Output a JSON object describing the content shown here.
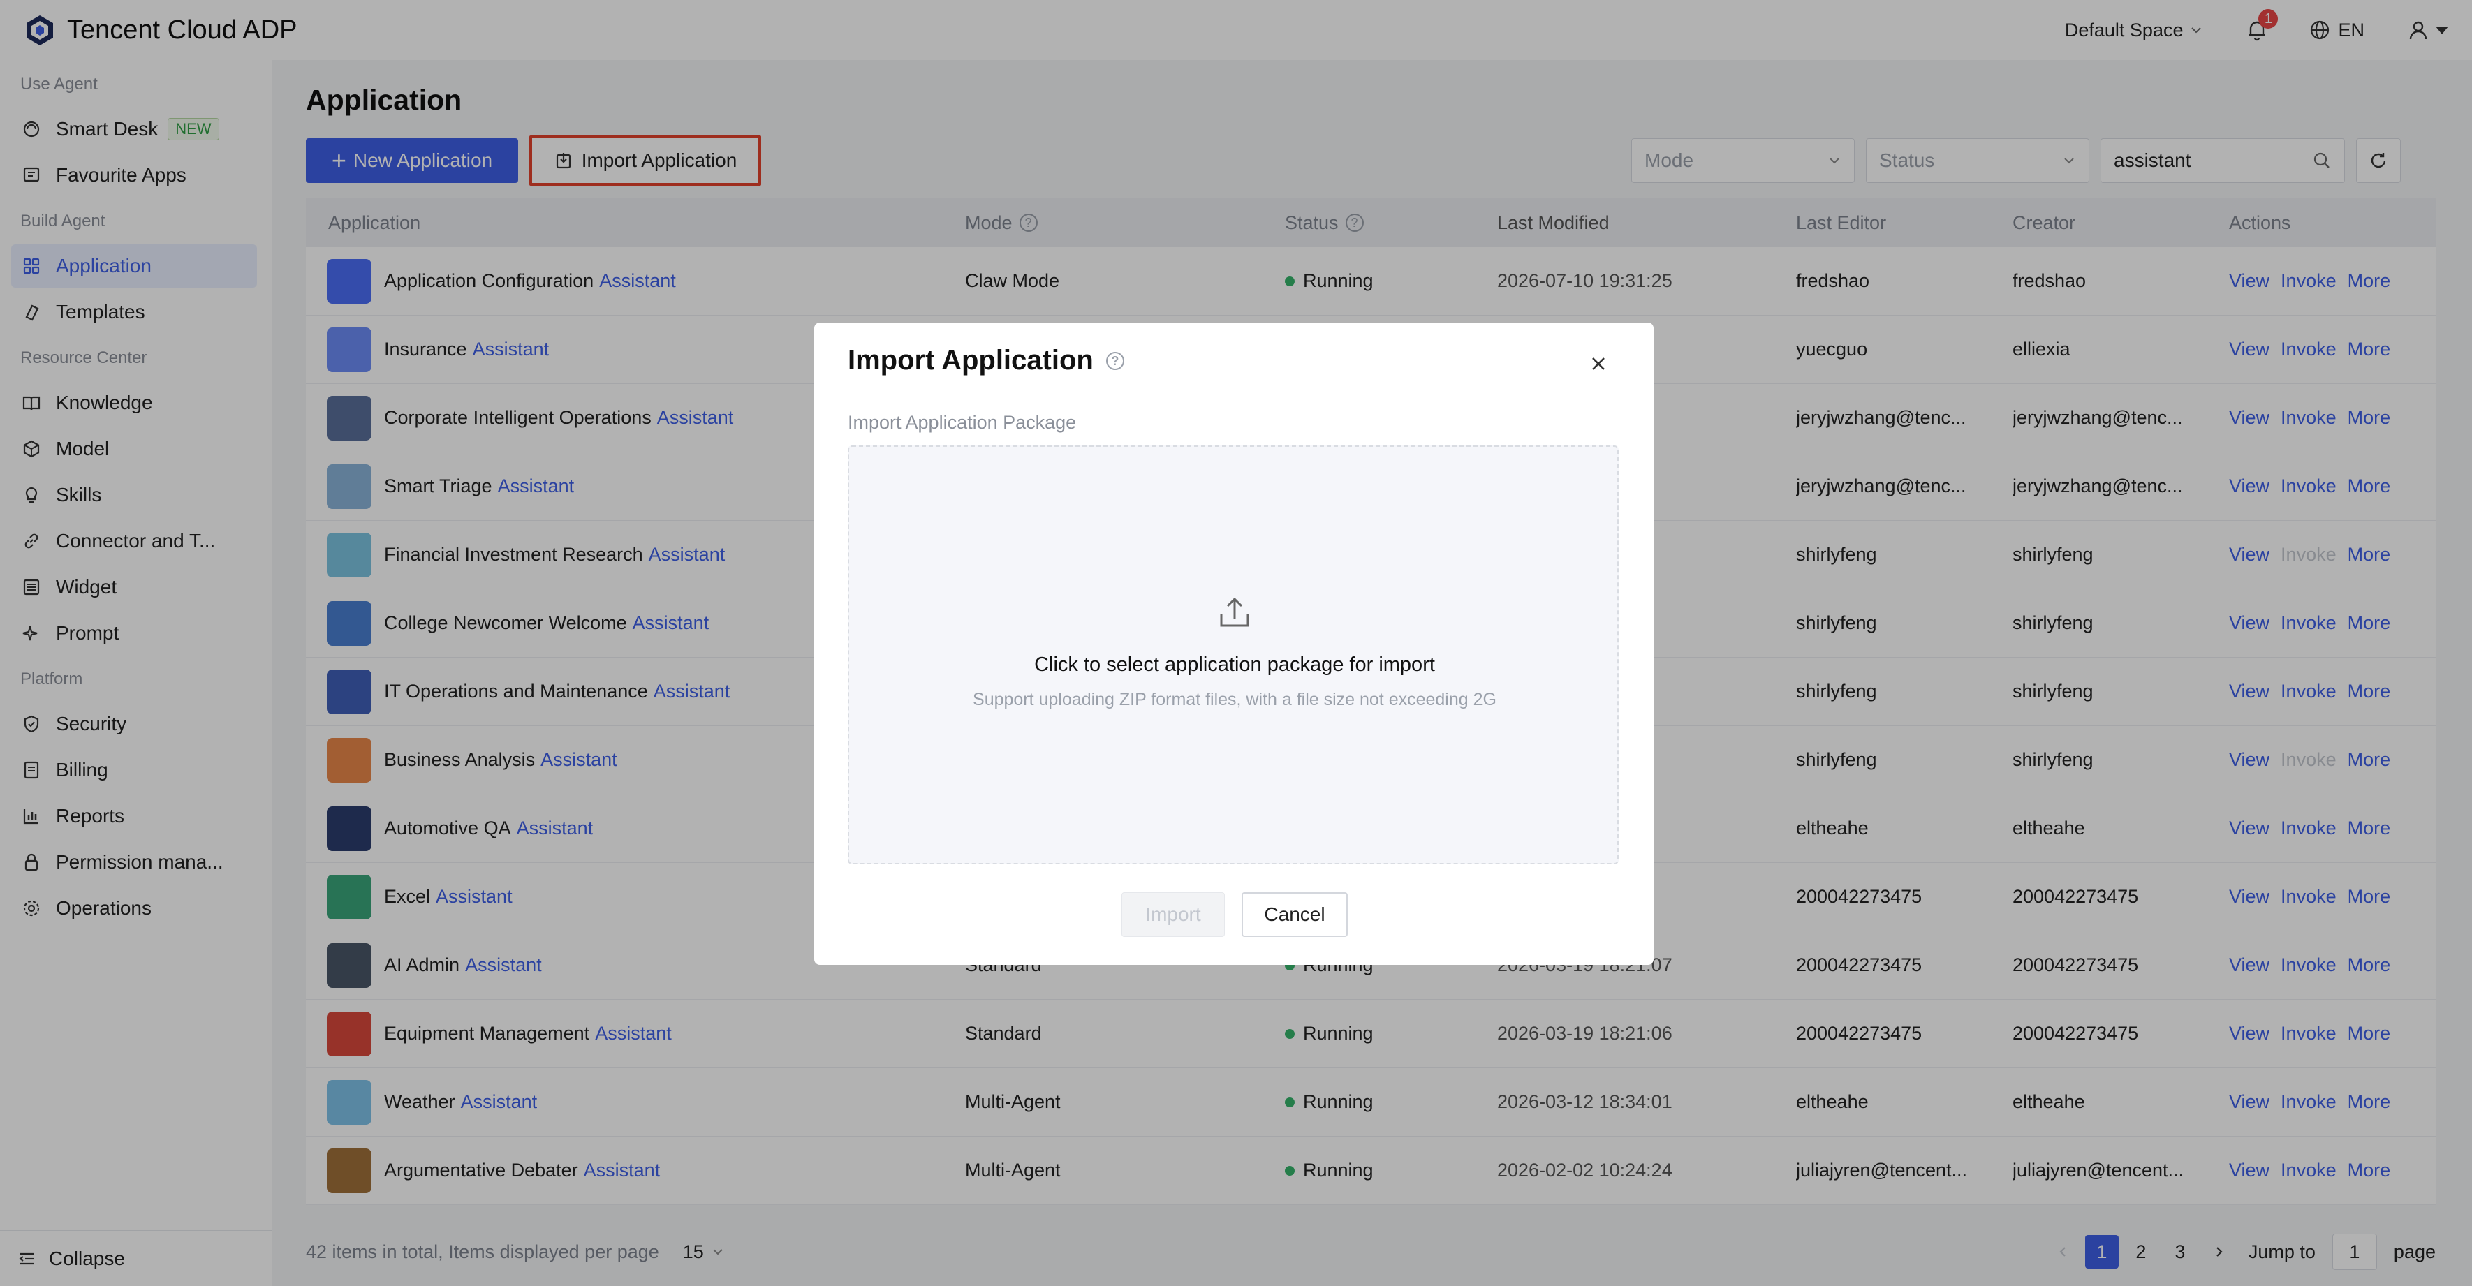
{
  "topbar": {
    "brand": "Tencent Cloud ADP",
    "space": "Default Space",
    "notifications": "1",
    "language": "EN"
  },
  "sidebar": {
    "groups": [
      {
        "title": "Use Agent",
        "items": [
          {
            "label": "Smart Desk",
            "icon": "smart-desk-icon",
            "badge": "NEW"
          },
          {
            "label": "Favourite Apps",
            "icon": "favourite-apps-icon"
          }
        ]
      },
      {
        "title": "Build Agent",
        "items": [
          {
            "label": "Application",
            "icon": "application-grid-icon",
            "active": true
          },
          {
            "label": "Templates",
            "icon": "templates-icon"
          }
        ]
      },
      {
        "title": "Resource Center",
        "items": [
          {
            "label": "Knowledge",
            "icon": "book-icon"
          },
          {
            "label": "Model",
            "icon": "cube-icon"
          },
          {
            "label": "Skills",
            "icon": "lightbulb-icon"
          },
          {
            "label": "Connector and T...",
            "icon": "link-icon"
          },
          {
            "label": "Widget",
            "icon": "widget-icon"
          },
          {
            "label": "Prompt",
            "icon": "sparkle-icon"
          }
        ]
      },
      {
        "title": "Platform",
        "items": [
          {
            "label": "Security",
            "icon": "shield-icon"
          },
          {
            "label": "Billing",
            "icon": "billing-icon"
          },
          {
            "label": "Reports",
            "icon": "bar-chart-icon"
          },
          {
            "label": "Permission mana...",
            "icon": "lock-icon"
          },
          {
            "label": "Operations",
            "icon": "gear-icon"
          }
        ]
      }
    ],
    "collapse": "Collapse"
  },
  "main": {
    "title": "Application",
    "new_button": "New Application",
    "import_button": "Import Application",
    "filters": {
      "mode_placeholder": "Mode",
      "status_placeholder": "Status",
      "search_value": "assistant"
    }
  },
  "table": {
    "headers": {
      "application": "Application",
      "mode": "Mode",
      "status": "Status",
      "last_modified": "Last Modified",
      "last_editor": "Last Editor",
      "creator": "Creator",
      "actions": "Actions"
    },
    "action_labels": {
      "view": "View",
      "invoke": "Invoke",
      "more": "More"
    },
    "rows": [
      {
        "name": "Application Configuration",
        "suffix": "Assistant",
        "mode": "Claw Mode",
        "status": "Running",
        "modified": "2026-07-10 19:31:25",
        "editor": "fredshao",
        "creator": "fredshao",
        "invoke_disabled": false,
        "icon_color": "#4b6ef5"
      },
      {
        "name": "Insurance",
        "suffix": "Assistant",
        "mode": "",
        "status": "",
        "modified": "31:27",
        "editor": "yuecguo",
        "creator": "elliexia",
        "invoke_disabled": false,
        "icon_color": "#6c8cf5"
      },
      {
        "name": "Corporate Intelligent Operations",
        "suffix": "Assistant",
        "mode": "",
        "status": "",
        "modified": "23:15",
        "editor": "jeryjwzhang@tenc...",
        "creator": "jeryjwzhang@tenc...",
        "invoke_disabled": false,
        "icon_color": "#5a6f9a"
      },
      {
        "name": "Smart Triage",
        "suffix": "Assistant",
        "mode": "",
        "status": "",
        "modified": "23:14",
        "editor": "jeryjwzhang@tenc...",
        "creator": "jeryjwzhang@tenc...",
        "invoke_disabled": false,
        "icon_color": "#8ab4d8"
      },
      {
        "name": "Financial Investment Research",
        "suffix": "Assistant",
        "mode": "",
        "status": "",
        "modified": "22:55",
        "editor": "shirlyfeng",
        "creator": "shirlyfeng",
        "invoke_disabled": true,
        "icon_color": "#7cc3e0"
      },
      {
        "name": "College Newcomer Welcome",
        "suffix": "Assistant",
        "mode": "",
        "status": "",
        "modified": "22:16",
        "editor": "shirlyfeng",
        "creator": "shirlyfeng",
        "invoke_disabled": false,
        "icon_color": "#4a7fd0"
      },
      {
        "name": "IT Operations and Maintenance",
        "suffix": "Assistant",
        "mode": "",
        "status": "",
        "modified": "22:06",
        "editor": "shirlyfeng",
        "creator": "shirlyfeng",
        "invoke_disabled": false,
        "icon_color": "#3f5fb8"
      },
      {
        "name": "Business Analysis",
        "suffix": "Assistant",
        "mode": "",
        "status": "",
        "modified": "22:00",
        "editor": "shirlyfeng",
        "creator": "shirlyfeng",
        "invoke_disabled": true,
        "icon_color": "#e8874a"
      },
      {
        "name": "Automotive QA",
        "suffix": "Assistant",
        "mode": "",
        "status": "",
        "modified": "21:54",
        "editor": "eltheahe",
        "creator": "eltheahe",
        "invoke_disabled": false,
        "icon_color": "#2b3d6e"
      },
      {
        "name": "Excel",
        "suffix": "Assistant",
        "mode": "",
        "status": "",
        "modified": "21:20",
        "editor": "200042273475",
        "creator": "200042273475",
        "invoke_disabled": false,
        "icon_color": "#3aa57a"
      },
      {
        "name": "AI Admin",
        "suffix": "Assistant",
        "mode": "Standard",
        "status": "Running",
        "modified": "2026-03-19 18:21:07",
        "editor": "200042273475",
        "creator": "200042273475",
        "invoke_disabled": false,
        "icon_color": "#4a5668"
      },
      {
        "name": "Equipment Management",
        "suffix": "Assistant",
        "mode": "Standard",
        "status": "Running",
        "modified": "2026-03-19 18:21:06",
        "editor": "200042273475",
        "creator": "200042273475",
        "invoke_disabled": false,
        "icon_color": "#d8483b"
      },
      {
        "name": "Weather",
        "suffix": "Assistant",
        "mode": "Multi-Agent",
        "status": "Running",
        "modified": "2026-03-12 18:34:01",
        "editor": "eltheahe",
        "creator": "eltheahe",
        "invoke_disabled": false,
        "icon_color": "#7fc2e8"
      },
      {
        "name": "Argumentative Debater",
        "suffix": "Assistant",
        "mode": "Multi-Agent",
        "status": "Running",
        "modified": "2026-02-02 10:24:24",
        "editor": "juliajyren@tencent...",
        "creator": "juliajyren@tencent...",
        "invoke_disabled": false,
        "icon_color": "#a0703a"
      }
    ]
  },
  "footer": {
    "total_text": "42 items in total, Items displayed per page",
    "page_size": "15",
    "pages": [
      "1",
      "2",
      "3"
    ],
    "current_page": "1",
    "jump_label": "Jump to",
    "jump_value": "1",
    "page_label": "page"
  },
  "modal": {
    "title": "Import Application",
    "label": "Import Application Package",
    "drop_title": "Click to select application package for import",
    "drop_subtitle": "Support uploading ZIP format files, with a file size not exceeding 2G",
    "import_button": "Import",
    "cancel_button": "Cancel"
  },
  "colors": {
    "primary": "#3e5fe6",
    "running": "#35b46b",
    "highlight_border": "#e2412c",
    "notification_badge": "#e84545"
  }
}
